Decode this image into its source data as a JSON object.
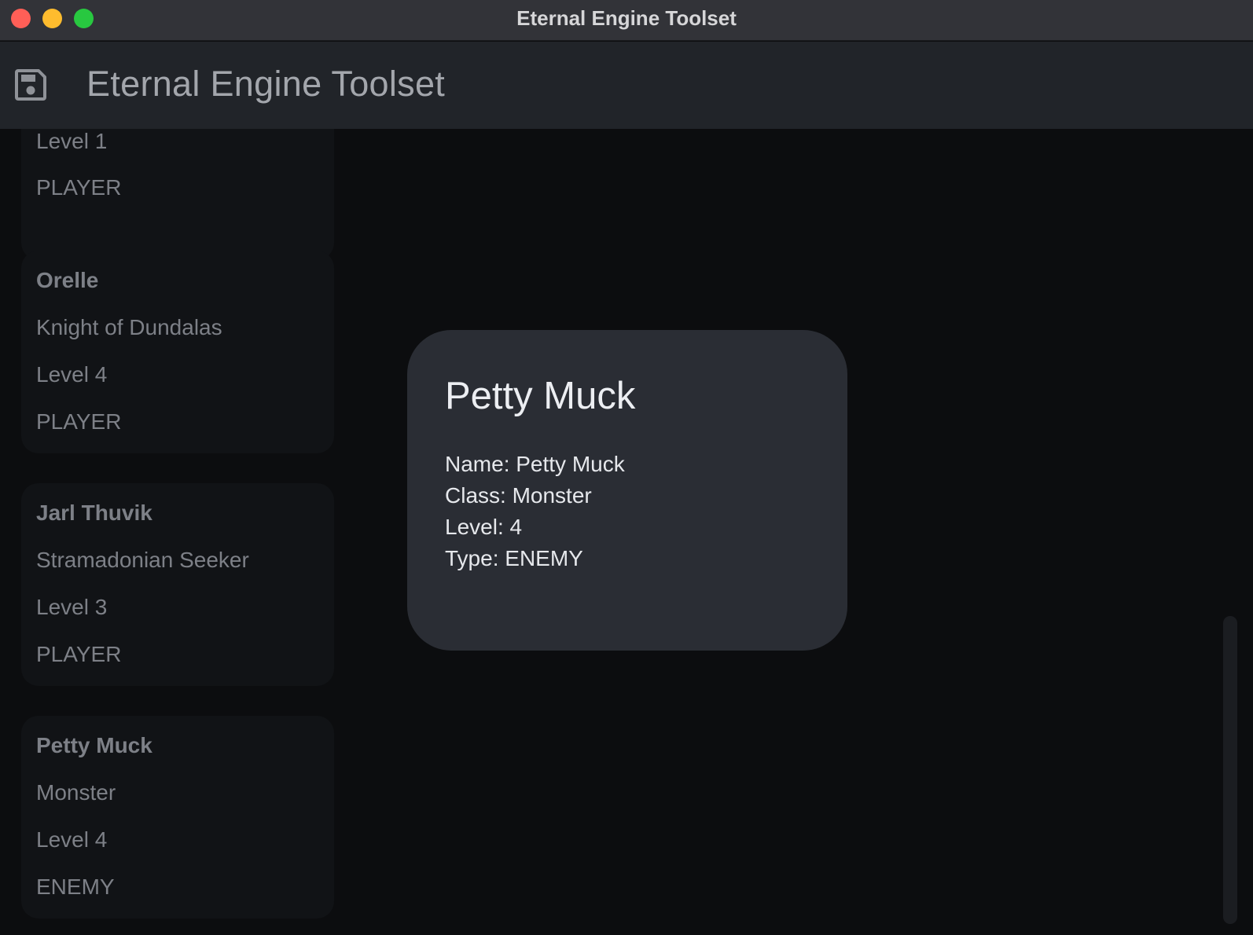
{
  "window": {
    "title": "Eternal Engine Toolset"
  },
  "appbar": {
    "title": "Eternal Engine Toolset",
    "save_icon": "save-icon"
  },
  "characters": [
    {
      "name": "",
      "class": "",
      "level": "Level 1",
      "type": "PLAYER"
    },
    {
      "name": "Orelle",
      "class": "Knight of Dundalas",
      "level": "Level 4",
      "type": "PLAYER"
    },
    {
      "name": "Jarl Thuvik",
      "class": "Stramadonian Seeker",
      "level": "Level 3",
      "type": "PLAYER"
    },
    {
      "name": "Petty Muck",
      "class": "Monster",
      "level": "Level 4",
      "type": "ENEMY"
    }
  ],
  "detail": {
    "title": "Petty Muck",
    "rows": [
      "Name: Petty Muck",
      "Class: Monster",
      "Level: 4",
      "Type: ENEMY"
    ]
  },
  "colors": {
    "close": "#ff5f57",
    "minimize": "#febc2e",
    "zoom": "#28c840",
    "panel": "#2a2d34",
    "card": "#111316"
  }
}
